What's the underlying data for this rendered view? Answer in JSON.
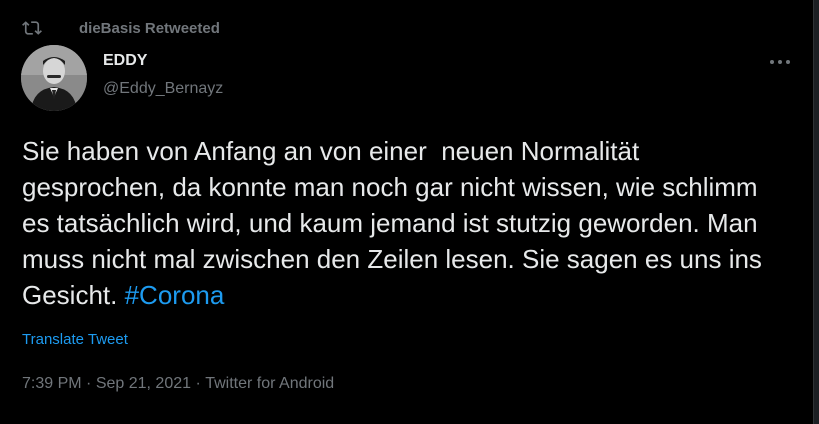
{
  "retweet": {
    "icon": "retweet-icon",
    "label": "dieBasis Retweeted"
  },
  "author": {
    "name": "EDDY",
    "handle": "@Eddy_Bernayz",
    "avatar": "avatar"
  },
  "more": {
    "icon": "more-dots-icon"
  },
  "tweet": {
    "text_main": "Sie haben von Anfang an von einer  neuen Normalität gesprochen, da konnte man noch gar nicht wissen, wie schlimm es tatsächlich wird, und kaum jemand ist stutzig geworden. Man muss nicht mal zwischen den Zeilen lesen. Sie sagen es uns ins Gesicht. ",
    "hashtag": "#Corona",
    "translate": "Translate Tweet"
  },
  "meta": {
    "time": "7:39 PM",
    "separator": " · ",
    "date": "Sep 21, 2021",
    "source": "Twitter for Android"
  },
  "colors": {
    "background": "#000000",
    "text": "#e7e9ea",
    "secondary": "#71767b",
    "accent": "#1d9bf0"
  }
}
